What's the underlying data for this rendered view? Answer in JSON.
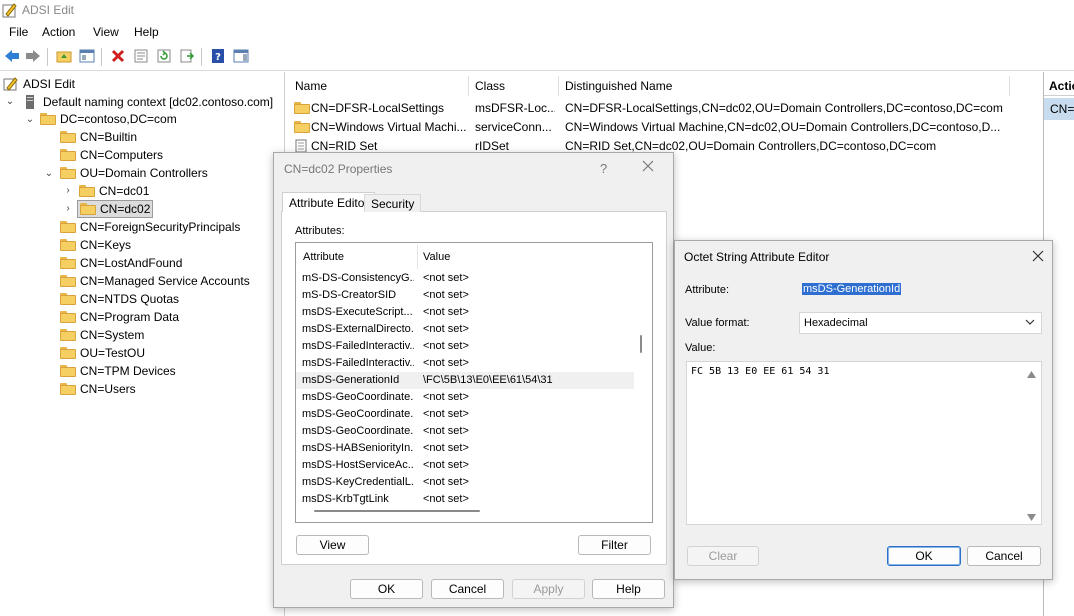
{
  "window": {
    "title": "ADSI Edit"
  },
  "menu": [
    "File",
    "Action",
    "View",
    "Help"
  ],
  "toolbar": {
    "icons": [
      "back-arrow-icon",
      "forward-arrow-icon",
      "up-folder-icon",
      "show-hide-tree-icon",
      "delete-icon",
      "properties-icon",
      "refresh-icon",
      "export-list-icon",
      "help-icon",
      "show-hide-action-pane-icon"
    ]
  },
  "tree": {
    "root": "ADSI Edit",
    "context": "Default naming context [dc02.contoso.com]",
    "domain": "DC=contoso,DC=com",
    "items": [
      "CN=Builtin",
      "CN=Computers",
      "OU=Domain Controllers",
      "CN=dc01",
      "CN=dc02",
      "CN=ForeignSecurityPrincipals",
      "CN=Keys",
      "CN=LostAndFound",
      "CN=Managed Service Accounts",
      "CN=NTDS Quotas",
      "CN=Program Data",
      "CN=System",
      "OU=TestOU",
      "CN=TPM Devices",
      "CN=Users"
    ]
  },
  "list": {
    "headers": {
      "name": "Name",
      "class": "Class",
      "dn": "Distinguished Name"
    },
    "rows": [
      {
        "name": "CN=DFSR-LocalSettings",
        "class": "msDFSR-Loc...",
        "dn": "CN=DFSR-LocalSettings,CN=dc02,OU=Domain Controllers,DC=contoso,DC=com"
      },
      {
        "name": "CN=Windows Virtual Machi...",
        "class": "serviceConn...",
        "dn": "CN=Windows Virtual Machine,CN=dc02,OU=Domain Controllers,DC=contoso,D..."
      },
      {
        "name": "CN=RID Set",
        "class": "rIDSet",
        "dn": "CN=RID Set,CN=dc02,OU=Domain Controllers,DC=contoso,DC=com"
      }
    ]
  },
  "actions": {
    "header": "Actio",
    "item": "CN="
  },
  "properties": {
    "title": "CN=dc02 Properties",
    "help_glyph": "?",
    "tabs": [
      "Attribute Editor",
      "Security"
    ],
    "attributes_label": "Attributes:",
    "col_attribute": "Attribute",
    "col_value": "Value",
    "rows": [
      {
        "attr": "mS-DS-ConsistencyG...",
        "value": "<not set>"
      },
      {
        "attr": "mS-DS-CreatorSID",
        "value": "<not set>"
      },
      {
        "attr": "msDS-ExecuteScript...",
        "value": "<not set>"
      },
      {
        "attr": "msDS-ExternalDirecto...",
        "value": "<not set>"
      },
      {
        "attr": "msDS-FailedInteractiv...",
        "value": "<not set>"
      },
      {
        "attr": "msDS-FailedInteractiv...",
        "value": "<not set>"
      },
      {
        "attr": "msDS-GenerationId",
        "value": "\\FC\\5B\\13\\E0\\EE\\61\\54\\31"
      },
      {
        "attr": "msDS-GeoCoordinate...",
        "value": "<not set>"
      },
      {
        "attr": "msDS-GeoCoordinate...",
        "value": "<not set>"
      },
      {
        "attr": "msDS-GeoCoordinate...",
        "value": "<not set>"
      },
      {
        "attr": "msDS-HABSeniorityIn...",
        "value": "<not set>"
      },
      {
        "attr": "msDS-HostServiceAc...",
        "value": "<not set>"
      },
      {
        "attr": "msDS-KeyCredentialL...",
        "value": "<not set>"
      },
      {
        "attr": "msDS-KrbTgtLink",
        "value": "<not set>"
      }
    ],
    "view_button": "View",
    "filter_button": "Filter",
    "ok_button": "OK",
    "cancel_button": "Cancel",
    "apply_button": "Apply",
    "help_button": "Help"
  },
  "octet_editor": {
    "title": "Octet String Attribute Editor",
    "attribute_label": "Attribute:",
    "attribute_value": "msDS-GenerationId",
    "format_label": "Value format:",
    "format_value": "Hexadecimal",
    "value_label": "Value:",
    "value_text": "FC 5B 13 E0 EE 61 54 31",
    "clear_button": "Clear",
    "ok_button": "OK",
    "cancel_button": "Cancel"
  },
  "colors": {
    "selection": "#2f6fd1",
    "accent": "#c7dcef"
  }
}
